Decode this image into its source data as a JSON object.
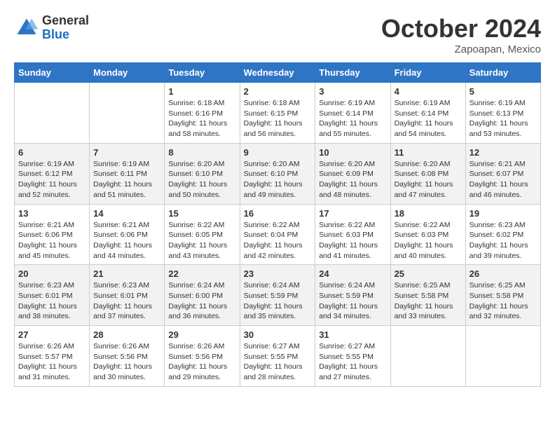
{
  "header": {
    "logo": {
      "general": "General",
      "blue": "Blue"
    },
    "month": "October 2024",
    "location": "Zapoapan, Mexico"
  },
  "weekdays": [
    "Sunday",
    "Monday",
    "Tuesday",
    "Wednesday",
    "Thursday",
    "Friday",
    "Saturday"
  ],
  "weeks": [
    [
      null,
      null,
      {
        "day": 1,
        "sunrise": "6:18 AM",
        "sunset": "6:16 PM",
        "daylight": "11 hours and 58 minutes."
      },
      {
        "day": 2,
        "sunrise": "6:18 AM",
        "sunset": "6:15 PM",
        "daylight": "11 hours and 56 minutes."
      },
      {
        "day": 3,
        "sunrise": "6:19 AM",
        "sunset": "6:14 PM",
        "daylight": "11 hours and 55 minutes."
      },
      {
        "day": 4,
        "sunrise": "6:19 AM",
        "sunset": "6:14 PM",
        "daylight": "11 hours and 54 minutes."
      },
      {
        "day": 5,
        "sunrise": "6:19 AM",
        "sunset": "6:13 PM",
        "daylight": "11 hours and 53 minutes."
      }
    ],
    [
      {
        "day": 6,
        "sunrise": "6:19 AM",
        "sunset": "6:12 PM",
        "daylight": "11 hours and 52 minutes."
      },
      {
        "day": 7,
        "sunrise": "6:19 AM",
        "sunset": "6:11 PM",
        "daylight": "11 hours and 51 minutes."
      },
      {
        "day": 8,
        "sunrise": "6:20 AM",
        "sunset": "6:10 PM",
        "daylight": "11 hours and 50 minutes."
      },
      {
        "day": 9,
        "sunrise": "6:20 AM",
        "sunset": "6:10 PM",
        "daylight": "11 hours and 49 minutes."
      },
      {
        "day": 10,
        "sunrise": "6:20 AM",
        "sunset": "6:09 PM",
        "daylight": "11 hours and 48 minutes."
      },
      {
        "day": 11,
        "sunrise": "6:20 AM",
        "sunset": "6:08 PM",
        "daylight": "11 hours and 47 minutes."
      },
      {
        "day": 12,
        "sunrise": "6:21 AM",
        "sunset": "6:07 PM",
        "daylight": "11 hours and 46 minutes."
      }
    ],
    [
      {
        "day": 13,
        "sunrise": "6:21 AM",
        "sunset": "6:06 PM",
        "daylight": "11 hours and 45 minutes."
      },
      {
        "day": 14,
        "sunrise": "6:21 AM",
        "sunset": "6:06 PM",
        "daylight": "11 hours and 44 minutes."
      },
      {
        "day": 15,
        "sunrise": "6:22 AM",
        "sunset": "6:05 PM",
        "daylight": "11 hours and 43 minutes."
      },
      {
        "day": 16,
        "sunrise": "6:22 AM",
        "sunset": "6:04 PM",
        "daylight": "11 hours and 42 minutes."
      },
      {
        "day": 17,
        "sunrise": "6:22 AM",
        "sunset": "6:03 PM",
        "daylight": "11 hours and 41 minutes."
      },
      {
        "day": 18,
        "sunrise": "6:22 AM",
        "sunset": "6:03 PM",
        "daylight": "11 hours and 40 minutes."
      },
      {
        "day": 19,
        "sunrise": "6:23 AM",
        "sunset": "6:02 PM",
        "daylight": "11 hours and 39 minutes."
      }
    ],
    [
      {
        "day": 20,
        "sunrise": "6:23 AM",
        "sunset": "6:01 PM",
        "daylight": "11 hours and 38 minutes."
      },
      {
        "day": 21,
        "sunrise": "6:23 AM",
        "sunset": "6:01 PM",
        "daylight": "11 hours and 37 minutes."
      },
      {
        "day": 22,
        "sunrise": "6:24 AM",
        "sunset": "6:00 PM",
        "daylight": "11 hours and 36 minutes."
      },
      {
        "day": 23,
        "sunrise": "6:24 AM",
        "sunset": "5:59 PM",
        "daylight": "11 hours and 35 minutes."
      },
      {
        "day": 24,
        "sunrise": "6:24 AM",
        "sunset": "5:59 PM",
        "daylight": "11 hours and 34 minutes."
      },
      {
        "day": 25,
        "sunrise": "6:25 AM",
        "sunset": "5:58 PM",
        "daylight": "11 hours and 33 minutes."
      },
      {
        "day": 26,
        "sunrise": "6:25 AM",
        "sunset": "5:58 PM",
        "daylight": "11 hours and 32 minutes."
      }
    ],
    [
      {
        "day": 27,
        "sunrise": "6:26 AM",
        "sunset": "5:57 PM",
        "daylight": "11 hours and 31 minutes."
      },
      {
        "day": 28,
        "sunrise": "6:26 AM",
        "sunset": "5:56 PM",
        "daylight": "11 hours and 30 minutes."
      },
      {
        "day": 29,
        "sunrise": "6:26 AM",
        "sunset": "5:56 PM",
        "daylight": "11 hours and 29 minutes."
      },
      {
        "day": 30,
        "sunrise": "6:27 AM",
        "sunset": "5:55 PM",
        "daylight": "11 hours and 28 minutes."
      },
      {
        "day": 31,
        "sunrise": "6:27 AM",
        "sunset": "5:55 PM",
        "daylight": "11 hours and 27 minutes."
      },
      null,
      null
    ]
  ],
  "labels": {
    "sunrise": "Sunrise:",
    "sunset": "Sunset:",
    "daylight": "Daylight:"
  }
}
